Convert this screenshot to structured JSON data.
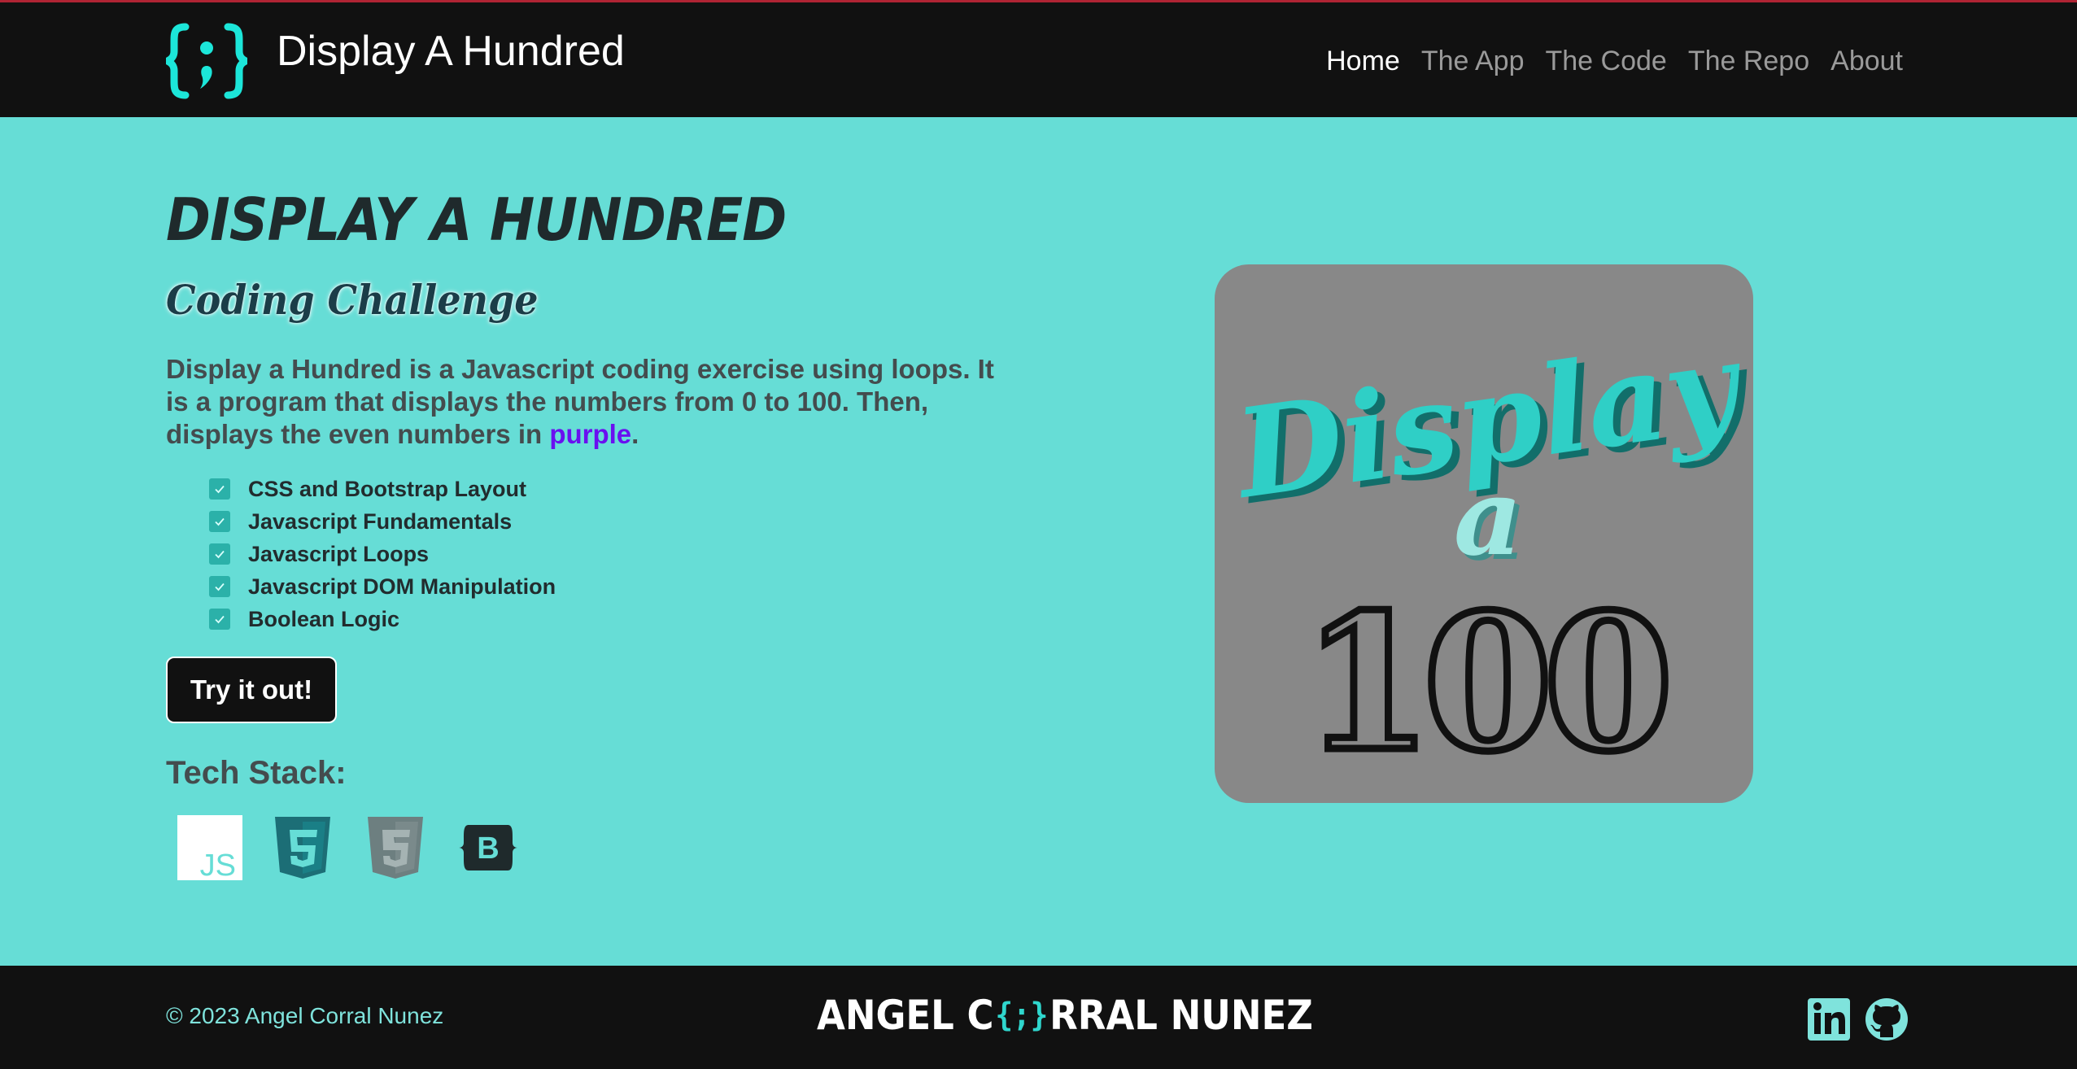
{
  "colors": {
    "accent": "#66ddd6",
    "dark": "#111111",
    "highlight_purple": "#6a10f0",
    "brand_teal": "#1ce6d9",
    "nav_top_border": "#b02434"
  },
  "navbar": {
    "brand_icon": "curly-brace-semicolon-icon",
    "brand_name": "Display A Hundred",
    "links": [
      "Home",
      "The App",
      "The Code",
      "The Repo",
      "About"
    ],
    "active_link": "Home"
  },
  "hero": {
    "title": "DISPLAY A HUNDRED",
    "subtitle": "Coding Challenge",
    "description_before": "Display a Hundred is a Javascript coding exercise using loops. It is a program that displays the numbers from 0 to 100. Then, displays the even numbers in ",
    "description_highlight": "purple",
    "description_after": ".",
    "features": [
      "CSS and Bootstrap Layout",
      "Javascript Fundamentals",
      "Javascript Loops",
      "Javascript DOM Manipulation",
      "Boolean Logic"
    ],
    "cta_label": "Try it out!",
    "tech_stack_title": "Tech Stack:",
    "tech_icons": [
      "javascript-icon",
      "html5-icon",
      "css3-icon",
      "bootstrap-icon"
    ],
    "image_text": {
      "line1": "Display",
      "line2": "a",
      "line3": "100"
    }
  },
  "footer": {
    "copyright": "© 2023 Angel Corral Nunez",
    "name_before": "ANGEL C",
    "name_brace": "{;}",
    "name_after": "RRAL NUNEZ",
    "social_icons": [
      "linkedin-icon",
      "github-icon"
    ]
  }
}
